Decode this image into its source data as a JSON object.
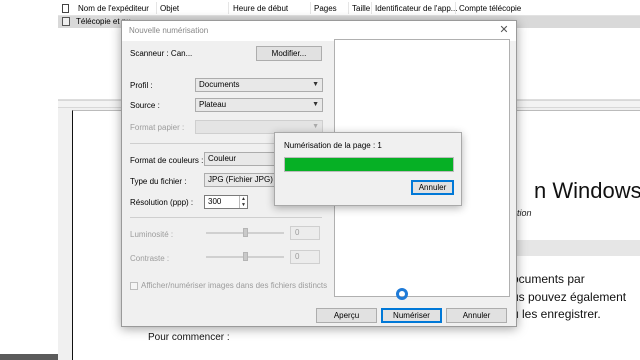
{
  "fax_list": {
    "columns": [
      "Nom de l'expéditeur",
      "Objet",
      "Heure de début",
      "Pages",
      "Taille",
      "Identificateur de l'app...",
      "Compte télécopie"
    ],
    "row": {
      "sender": "Télécopie et nu"
    }
  },
  "document": {
    "title": "n Windows",
    "trademark": "®",
    "subtitle": "ation",
    "paragraph_lines": [
      "ocuments par",
      "us pouvez également",
      "u les enregistrer."
    ],
    "start_text": "Pour commencer :"
  },
  "scan_dialog": {
    "title": "Nouvelle numérisation",
    "scanner_label": "Scanneur : Can...",
    "modify_button": "Modifier...",
    "profile_label": "Profil :",
    "profile_value": "Documents",
    "source_label": "Source :",
    "source_value": "Plateau",
    "paper_format_label": "Format papier :",
    "paper_format_value": "",
    "color_format_label": "Format de couleurs :",
    "color_format_value": "Couleur",
    "file_type_label": "Type du fichier :",
    "file_type_value": "JPG (Fichier JPG)",
    "resolution_label": "Résolution (ppp) :",
    "resolution_value": "300",
    "brightness_label": "Luminosité :",
    "brightness_value": "0",
    "contrast_label": "Contraste :",
    "contrast_value": "0",
    "separate_files_label": "Afficher/numériser images dans des fichiers distincts",
    "separate_files_checked": false,
    "preview_button": "Aperçu",
    "scan_button": "Numériser",
    "cancel_button": "Annuler"
  },
  "progress_dialog": {
    "message": "Numérisation de la page : 1",
    "progress": 1.0,
    "cancel_button": "Annuler",
    "color": "#06b025"
  },
  "colors": {
    "progress_green": "#06b025",
    "focus_blue": "#0078d7",
    "cursor_blue": "#1e7ad7"
  }
}
